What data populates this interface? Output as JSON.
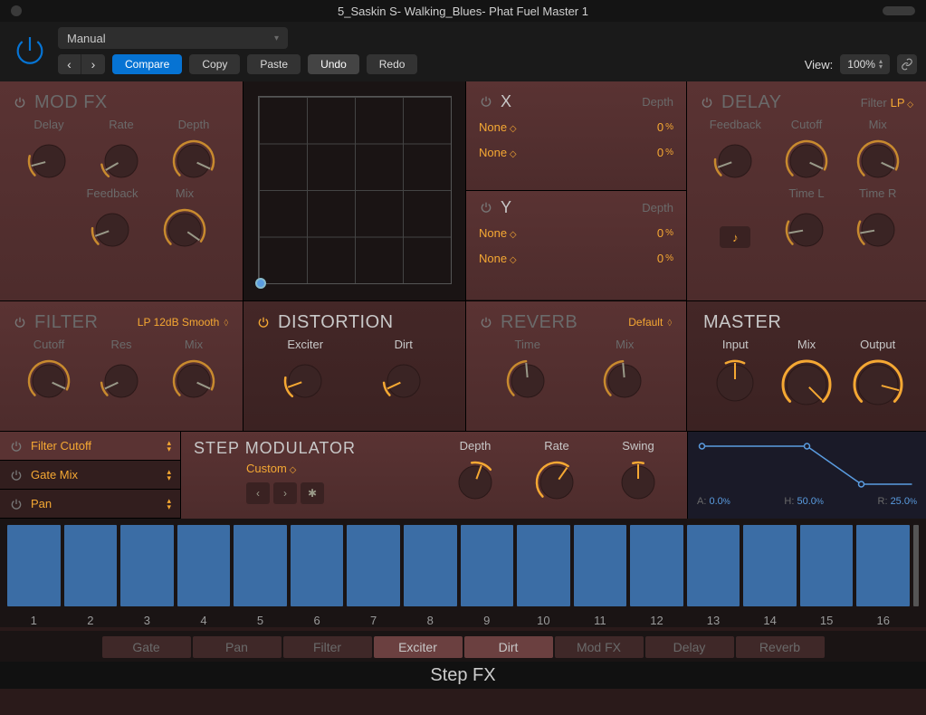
{
  "window": {
    "title": "5_Saskin S- Walking_Blues- Phat Fuel Master 1"
  },
  "toolbar": {
    "preset": "Manual",
    "compare": "Compare",
    "copy": "Copy",
    "paste": "Paste",
    "undo": "Undo",
    "redo": "Redo",
    "view_label": "View:",
    "zoom": "100%"
  },
  "colors": {
    "accent": "#f5a833",
    "blue": "#3b6da5"
  },
  "modfx": {
    "title": "MOD FX",
    "knobs1": [
      "Delay",
      "Rate",
      "Depth"
    ],
    "knobs2": [
      "Feedback",
      "Mix"
    ]
  },
  "xy": {
    "x_label": "X",
    "y_label": "Y",
    "depth_label": "Depth",
    "x_rows": [
      {
        "param": "None",
        "value": "0",
        "unit": "%"
      },
      {
        "param": "None",
        "value": "0",
        "unit": "%"
      }
    ],
    "y_rows": [
      {
        "param": "None",
        "value": "0",
        "unit": "%"
      },
      {
        "param": "None",
        "value": "0",
        "unit": "%"
      }
    ]
  },
  "delay": {
    "title": "DELAY",
    "filter_label": "Filter",
    "filter_value": "LP",
    "knobs1": [
      "Feedback",
      "Cutoff",
      "Mix"
    ],
    "knobs2": [
      "",
      "Time L",
      "Time R"
    ]
  },
  "filter": {
    "title": "FILTER",
    "mode": "LP 12dB Smooth",
    "knobs": [
      "Cutoff",
      "Res",
      "Mix"
    ]
  },
  "distortion": {
    "title": "DISTORTION",
    "knobs": [
      "Exciter",
      "Dirt"
    ]
  },
  "reverb": {
    "title": "REVERB",
    "preset": "Default",
    "knobs": [
      "Time",
      "Mix"
    ]
  },
  "master": {
    "title": "MASTER",
    "knobs": [
      "Input",
      "Mix",
      "Output"
    ]
  },
  "modlist": [
    {
      "name": "Filter Cutoff",
      "selected": true
    },
    {
      "name": "Gate Mix",
      "selected": false
    },
    {
      "name": "Pan",
      "selected": false
    }
  ],
  "stepmod": {
    "title": "STEP MODULATOR",
    "preset": "Custom",
    "knobs": [
      "Depth",
      "Rate",
      "Swing"
    ]
  },
  "env": {
    "a_label": "A:",
    "a_value": "0.0",
    "a_unit": "%",
    "h_label": "H:",
    "h_value": "50.0",
    "h_unit": "%",
    "r_label": "R:",
    "r_value": "25.0",
    "r_unit": "%"
  },
  "steps": {
    "count": 16,
    "labels": [
      "1",
      "2",
      "3",
      "4",
      "5",
      "6",
      "7",
      "8",
      "9",
      "10",
      "11",
      "12",
      "13",
      "14",
      "15",
      "16"
    ]
  },
  "tabs": [
    {
      "label": "Gate",
      "active": false
    },
    {
      "label": "Pan",
      "active": false
    },
    {
      "label": "Filter",
      "active": false
    },
    {
      "label": "Exciter",
      "active": true
    },
    {
      "label": "Dirt",
      "active": true
    },
    {
      "label": "Mod FX",
      "active": false
    },
    {
      "label": "Delay",
      "active": false
    },
    {
      "label": "Reverb",
      "active": false
    }
  ],
  "footer": "Step FX"
}
